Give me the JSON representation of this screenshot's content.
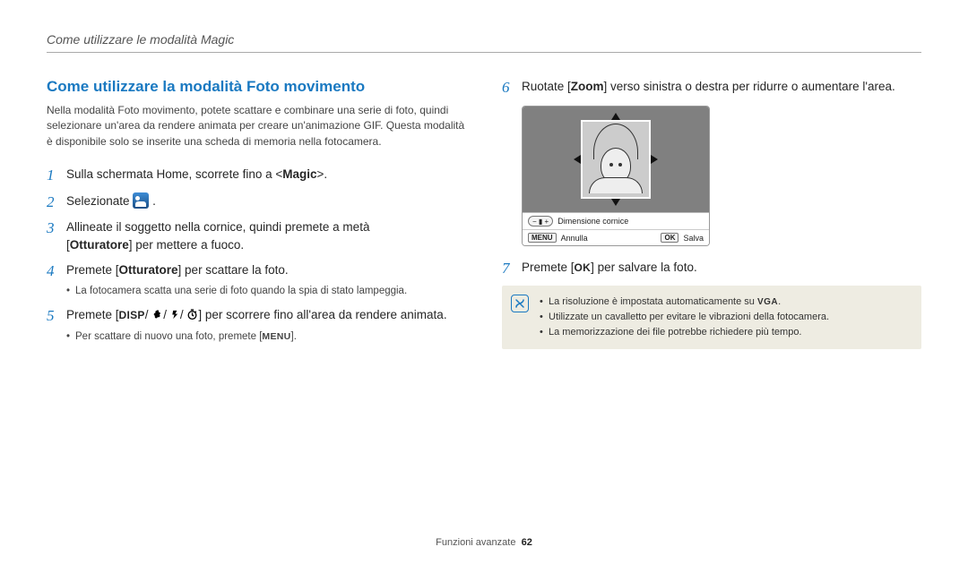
{
  "header": {
    "breadcrumb": "Come utilizzare le modalità Magic"
  },
  "section": {
    "title": "Come utilizzare la modalità Foto movimento",
    "intro": "Nella modalità Foto movimento, potete scattare e combinare una serie di foto, quindi selezionare un'area da rendere animata per creare un'animazione GIF. Questa modalità è disponibile solo se inserite una scheda di memoria nella fotocamera."
  },
  "steps": {
    "s1": {
      "num": "1",
      "pre": "Sulla schermata Home, scorrete fino a <",
      "magic": "Magic",
      "post": ">."
    },
    "s2": {
      "num": "2",
      "pre": "Selezionate ",
      "post": " ."
    },
    "s3": {
      "num": "3",
      "line1a": "Allineate il soggetto nella cornice, quindi premete a metà",
      "line2a": "[",
      "shutter": "Otturatore",
      "line2b": "] per mettere a fuoco."
    },
    "s4": {
      "num": "4",
      "a": "Premete [",
      "shutter": "Otturatore",
      "b": "] per scattare la foto.",
      "sub": "La fotocamera scatta una serie di foto quando la spia di stato lampeggia."
    },
    "s5": {
      "num": "5",
      "a": "Premete [",
      "b": "] per scorrere fino all'area da rendere animata.",
      "sub_a": "Per scattare di nuovo una foto, premete [",
      "sub_b": "]."
    },
    "s6": {
      "num": "6",
      "a": "Ruotate [",
      "zoom": "Zoom",
      "b": "] verso sinistra o destra per ridurre o aumentare l'area."
    },
    "s7": {
      "num": "7",
      "a": "Premete [",
      "b": "] per salvare la foto."
    }
  },
  "buttons": {
    "disp": "DISP",
    "ok": "OK",
    "menu": "MENU"
  },
  "preview": {
    "size_label": "Dimensione cornice",
    "cancel": "Annulla",
    "save": "Salva"
  },
  "note": {
    "l1a": "La risoluzione è impostata automaticamente su ",
    "l1_vga": "VGA",
    "l1b": ".",
    "l2": "Utilizzate un cavalletto per evitare le vibrazioni della fotocamera.",
    "l3": "La memorizzazione dei file potrebbe richiedere più tempo."
  },
  "footer": {
    "section": "Funzioni avanzate",
    "page": "62"
  }
}
